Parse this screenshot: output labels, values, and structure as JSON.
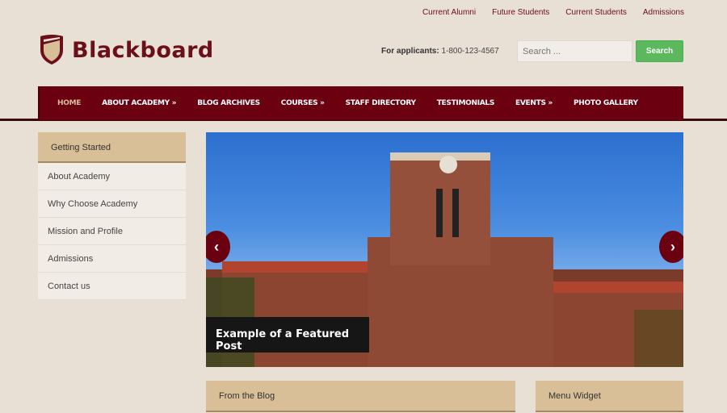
{
  "top_links": [
    "Current Alumni",
    "Future Students",
    "Current Students",
    "Admissions"
  ],
  "logo": {
    "text": "Blackboard"
  },
  "applicants": {
    "label": "For applicants:",
    "phone": "1-800-123-4567"
  },
  "search": {
    "placeholder": "Search ...",
    "button": "Search"
  },
  "nav": [
    "HOME",
    "ABOUT ACADEMY »",
    "BLOG ARCHIVES",
    "COURSES »",
    "STAFF DIRECTORY",
    "TESTIMONIALS",
    "EVENTS »",
    "PHOTO GALLERY"
  ],
  "sidebar": {
    "title": "Getting Started",
    "items": [
      "About Academy",
      "Why Choose Academy",
      "Mission and Profile",
      "Admissions",
      "Contact us"
    ]
  },
  "slider": {
    "caption": "Example of a Featured Post",
    "prev": "‹",
    "next": "›"
  },
  "widgets": {
    "blog": "From the Blog",
    "menu": "Menu Widget"
  },
  "colors": {
    "brand": "#6b0010",
    "accent": "#d9bf97",
    "search": "#5cb85c"
  }
}
